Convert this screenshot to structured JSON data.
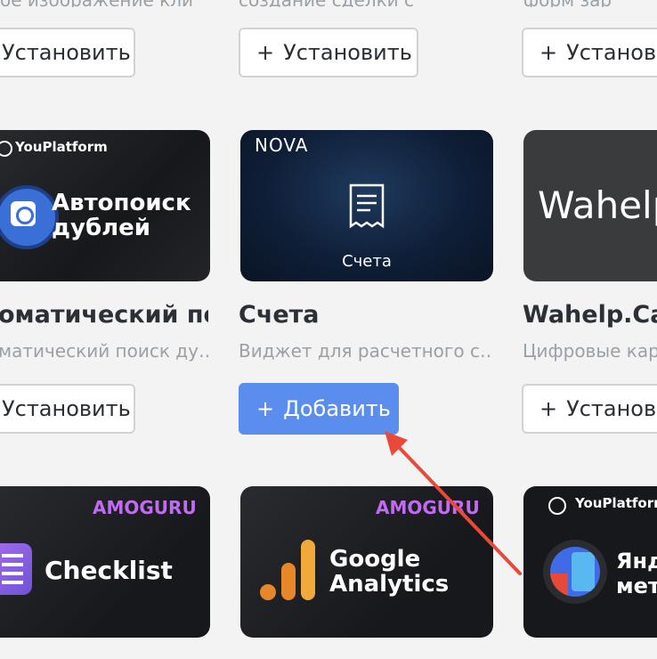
{
  "row1": {
    "install_label": "Установить"
  },
  "row2": {
    "card1": {
      "brand": "YouPlatform",
      "banner_text_line1": "Автопоиск",
      "banner_text_line2": "дублей",
      "title": "оматический по…",
      "description": "матический поиск ду…",
      "button_label": "Установить"
    },
    "card2": {
      "brand": "NOVA",
      "banner_caption": "Счета",
      "title": "Счета",
      "description": "Виджет для расчетного с…",
      "button_label": "Добавить"
    },
    "card3": {
      "banner_text": "Wahelp",
      "title": "Wahelp.Card",
      "description": "Цифровые кар",
      "button_label": "Установи"
    }
  },
  "row3": {
    "card1": {
      "brand": "AMOGURU",
      "banner_text": "Checklist"
    },
    "card2": {
      "brand": "AMOGURU",
      "banner_text_line1": "Google",
      "banner_text_line2": "Analytics"
    },
    "card3": {
      "brand": "YouPlatform",
      "banner_text_line1": "Янд",
      "banner_text_line2": "мет"
    }
  },
  "colors": {
    "background": "#f3f3f3",
    "primary_button": "#5b8def",
    "annotation_arrow": "#e84a3a",
    "card_dark": "#1b1c1f"
  },
  "icons": [
    "plus-icon",
    "receipt-icon",
    "search-sync-icon",
    "checklist-icon",
    "analytics-bars-icon",
    "yandex-metrica-icon",
    "youplatform-logo-icon"
  ]
}
